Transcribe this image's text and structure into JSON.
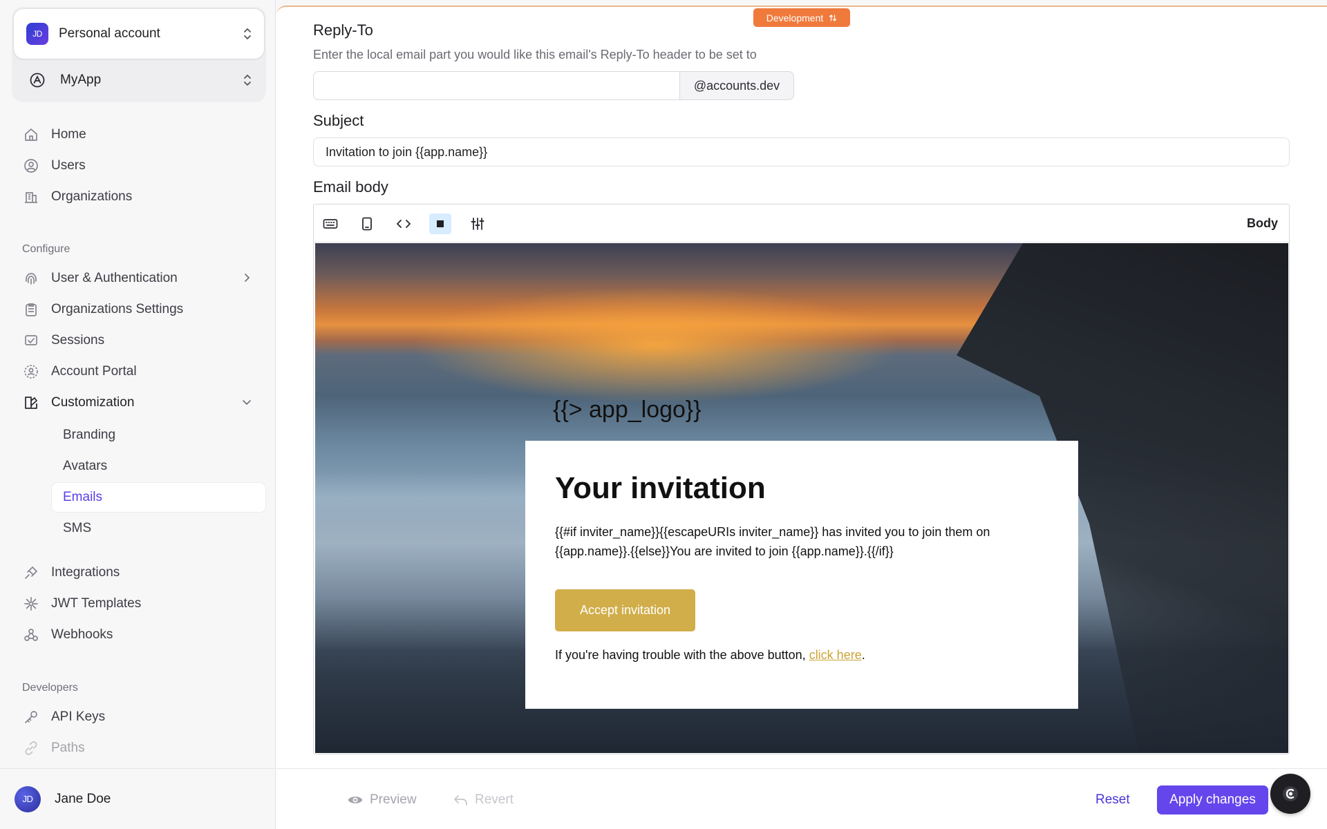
{
  "account": {
    "initials": "JD",
    "label": "Personal account"
  },
  "app": {
    "label": "MyApp"
  },
  "nav": {
    "home": "Home",
    "users": "Users",
    "organizations": "Organizations",
    "configure_label": "Configure",
    "user_auth": "User & Authentication",
    "org_settings": "Organizations Settings",
    "sessions": "Sessions",
    "account_portal": "Account Portal",
    "customization": "Customization",
    "branding": "Branding",
    "avatars": "Avatars",
    "emails": "Emails",
    "sms": "SMS",
    "integrations": "Integrations",
    "jwt_templates": "JWT Templates",
    "webhooks": "Webhooks",
    "developers_label": "Developers",
    "api_keys": "API Keys",
    "paths": "Paths"
  },
  "user": {
    "initials": "JD",
    "name": "Jane Doe"
  },
  "env_badge": "Development",
  "form": {
    "reply_to_label": "Reply-To",
    "reply_to_help": "Enter the local email part you would like this email's Reply-To header to be set to",
    "reply_to_value": "",
    "reply_to_suffix": "@accounts.dev",
    "subject_label": "Subject",
    "subject_value": "Invitation to join {{app.name}}",
    "body_label": "Email body"
  },
  "editor": {
    "mode_label": "Body",
    "logo_placeholder": "{{> app_logo}}",
    "title": "Your invitation",
    "text": "{{#if inviter_name}}{{escapeURIs inviter_name}} has invited you to join them on {{app.name}}.{{else}}You are invited to join {{app.name}}.{{/if}}",
    "button": "Accept invitation",
    "foot_text": "If you're having trouble with the above button, ",
    "foot_link": "click here",
    "foot_end": "."
  },
  "footer": {
    "preview": "Preview",
    "revert": "Revert",
    "reset": "Reset",
    "apply": "Apply changes"
  }
}
